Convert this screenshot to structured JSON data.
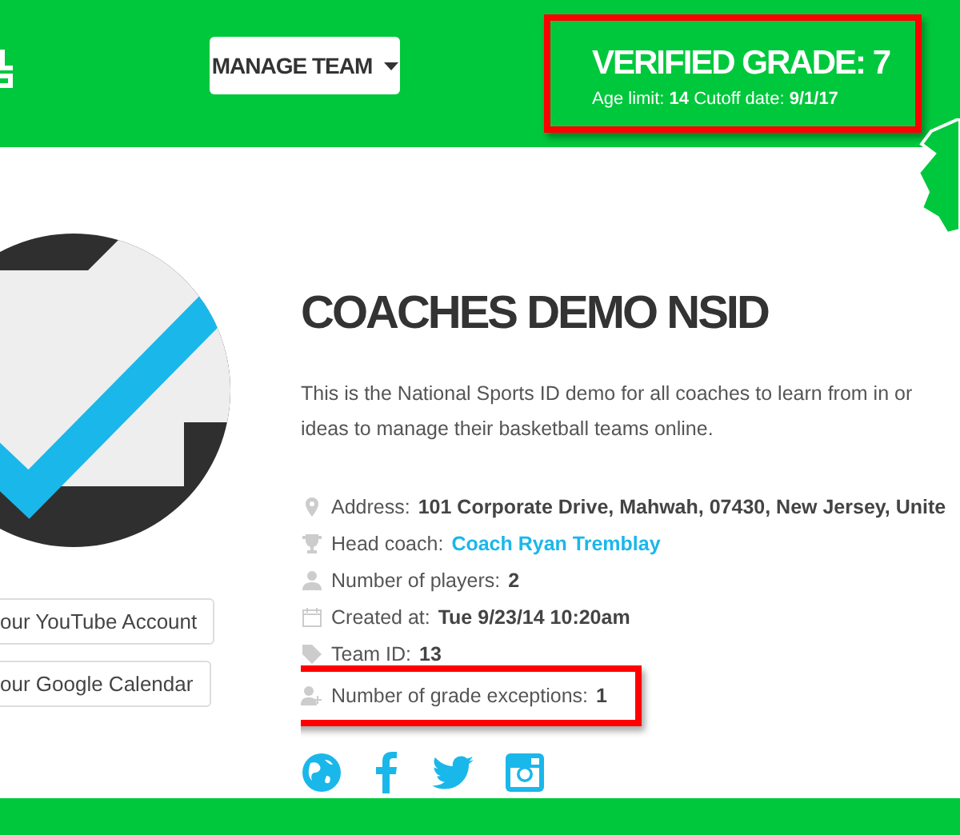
{
  "header": {
    "menu_button": "MANAGE TEAM",
    "grade": {
      "title": "VERIFIED GRADE: 7",
      "details": "Age limit: **14** Cutoff date: **9/1/17**",
      "highlighted": true
    }
  },
  "profile": {
    "buttons": [
      "our YouTube Account",
      "our Google Calendar"
    ],
    "title": "COACHES DEMO NSID",
    "description": [
      "This is the National Sports ID demo for all coaches to learn from in or",
      "ideas to manage their basketball teams online."
    ],
    "details": [
      {
        "label": "Address:",
        "value": "101 Corporate Drive, Mahwah, 07430, New Jersey, Unite",
        "link": false,
        "highlighted": false
      },
      {
        "label": "Head coach:",
        "value": "Coach Ryan Tremblay",
        "link": true,
        "highlighted": false
      },
      {
        "label": "Number of players:",
        "value": "2",
        "link": false,
        "highlighted": false
      },
      {
        "label": "Created at:",
        "value": "Tue 9/23/14 10:20am",
        "link": false,
        "highlighted": false
      },
      {
        "label": "Team ID:",
        "value": "13",
        "link": false,
        "highlighted": false
      },
      {
        "label": "Number of grade exceptions:",
        "value": "1",
        "link": false,
        "highlighted": true
      }
    ]
  }
}
